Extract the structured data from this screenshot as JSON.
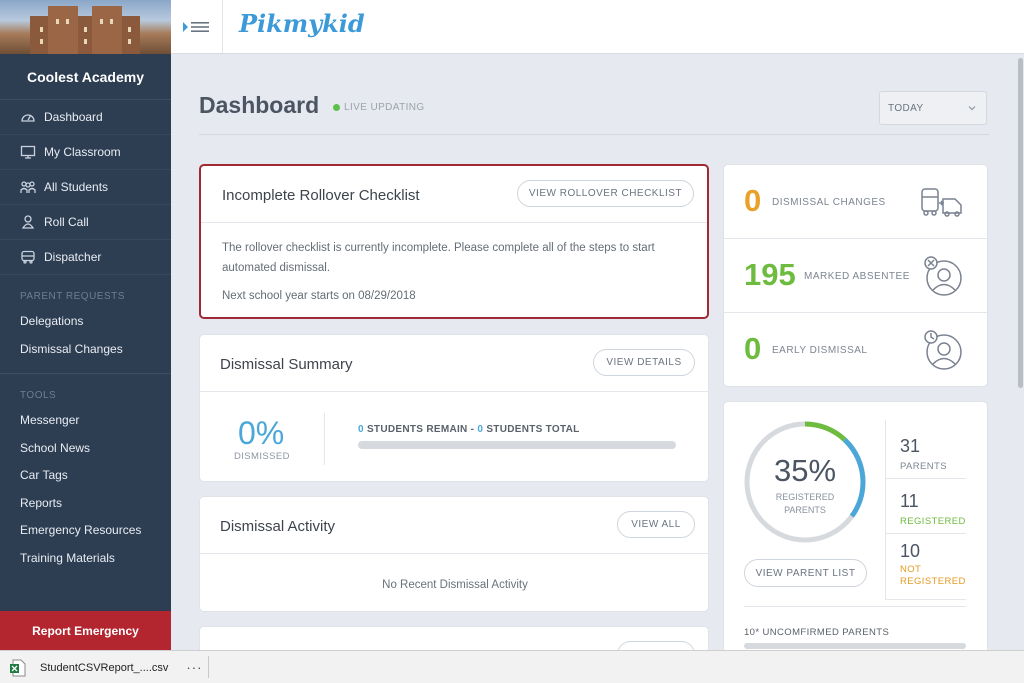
{
  "sidebar": {
    "school_name": "Coolest Academy",
    "nav": [
      {
        "label": "Dashboard",
        "icon": "dashboard-gauge-icon"
      },
      {
        "label": "My Classroom",
        "icon": "monitor-icon"
      },
      {
        "label": "All Students",
        "icon": "students-icon"
      },
      {
        "label": "Roll Call",
        "icon": "roll-call-icon"
      },
      {
        "label": "Dispatcher",
        "icon": "dispatcher-bus-icon"
      }
    ],
    "parent_requests_heading": "PARENT REQUESTS",
    "parent_requests": [
      "Delegations",
      "Dismissal Changes"
    ],
    "tools_heading": "TOOLS",
    "tools": [
      "Messenger",
      "School News",
      "Car Tags",
      "Reports",
      "Emergency Resources",
      "Training Materials"
    ],
    "report_emergency": "Report Emergency"
  },
  "topbar": {
    "menu_icon": "sidebar-toggle-icon",
    "logo": "Pikmykid"
  },
  "header": {
    "title": "Dashboard",
    "live_status": "LIVE UPDATING",
    "date_range": "TODAY"
  },
  "rollover": {
    "title": "Incomplete Rollover Checklist",
    "button": "VIEW ROLLOVER CHECKLIST",
    "message": "The rollover checklist is currently incomplete. Please complete all of the steps to start automated dismissal.",
    "next_year": "Next school year starts on 08/29/2018"
  },
  "summary": {
    "title": "Dismissal Summary",
    "button": "VIEW DETAILS",
    "percent": "0%",
    "percent_label": "DISMISSED",
    "remain_count": "0",
    "remain_text": " STUDENTS REMAIN - ",
    "total_count": "0",
    "total_text": " STUDENTS TOTAL",
    "progress_fraction": 0
  },
  "activity": {
    "title": "Dismissal Activity",
    "button": "VIEW ALL",
    "empty": "No Recent Dismissal Activity"
  },
  "stats": [
    {
      "value": "0",
      "label": "DISMISSAL CHANGES",
      "color": "#e8a12a",
      "icon": "vehicles-icon"
    },
    {
      "value": "195",
      "label": "MARKED ABSENTEE",
      "color": "#6dbb3f",
      "icon": "absent-person-icon"
    },
    {
      "value": "0",
      "label": "EARLY DISMISSAL",
      "color": "#6dbb3f",
      "icon": "early-clock-person-icon"
    }
  ],
  "parents": {
    "percent": "35%",
    "ring_label_1": "REGISTERED",
    "ring_label_2": "PARENTS",
    "registered_fraction": 0.35,
    "button": "VIEW PARENT LIST",
    "total": "31",
    "total_label": "PARENTS",
    "registered": "11",
    "registered_label": "REGISTERED",
    "not_registered": "10",
    "not_registered_label_1": "NOT",
    "not_registered_label_2": "REGISTERED",
    "unconfirmed": "10* UNCOMFIRMED PARENTS"
  },
  "download": {
    "filename": "StudentCSVReport_....csv",
    "more": "···",
    "icon": "excel-file-icon"
  },
  "colors": {
    "sidebar": "#2d3d52",
    "accent_blue": "#4aa7d8",
    "green": "#6dbb3f",
    "orange": "#e8a12a",
    "alert_red": "#b3262f"
  }
}
